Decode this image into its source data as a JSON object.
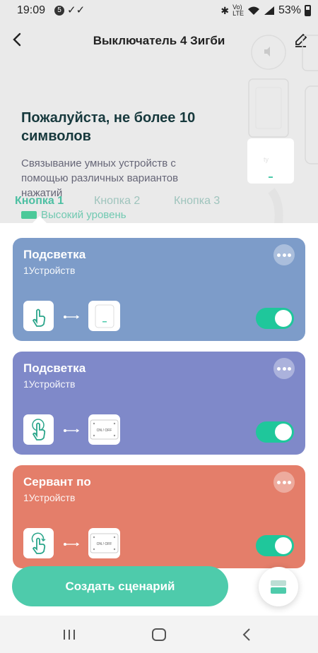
{
  "status_bar": {
    "time": "19:09",
    "notif_badge": "5",
    "battery": "53%"
  },
  "header": {
    "title": "Выключатель 4 Зигби",
    "back_icon": "chevron-left-icon",
    "edit_icon": "pencil-icon"
  },
  "hint": {
    "title": "Пожалуйста, не более 10 символов",
    "description": "Связывание умных устройств с помощью различных вариантов нажатий"
  },
  "tabs": [
    {
      "label": "Кнопка 1",
      "active": true
    },
    {
      "label": "Кнопка 2",
      "active": false
    },
    {
      "label": "Кнопка 3",
      "active": false
    }
  ],
  "battery_level": {
    "label": "Высокий уровень",
    "color": "#4cc999"
  },
  "scenes": [
    {
      "name": "Подсветка",
      "count": "1Устройств",
      "action_icon": "single-tap-icon",
      "device": "hub-device",
      "enabled": true,
      "color": "#7d9cc9"
    },
    {
      "name": "Подсветка",
      "count": "1Устройств",
      "action_icon": "double-tap-icon",
      "device": "switch-device",
      "enabled": true,
      "color": "#7f89c9"
    },
    {
      "name": "Сервант по",
      "count": "1Устройств",
      "action_icon": "long-press-icon",
      "device": "switch-device",
      "enabled": true,
      "color": "#e47e6a"
    }
  ],
  "switch_device_label": "ON / OFF",
  "create_button": {
    "label": "Создать сценарий",
    "color": "#4ecbab"
  },
  "accent_color": "#1fc79b"
}
